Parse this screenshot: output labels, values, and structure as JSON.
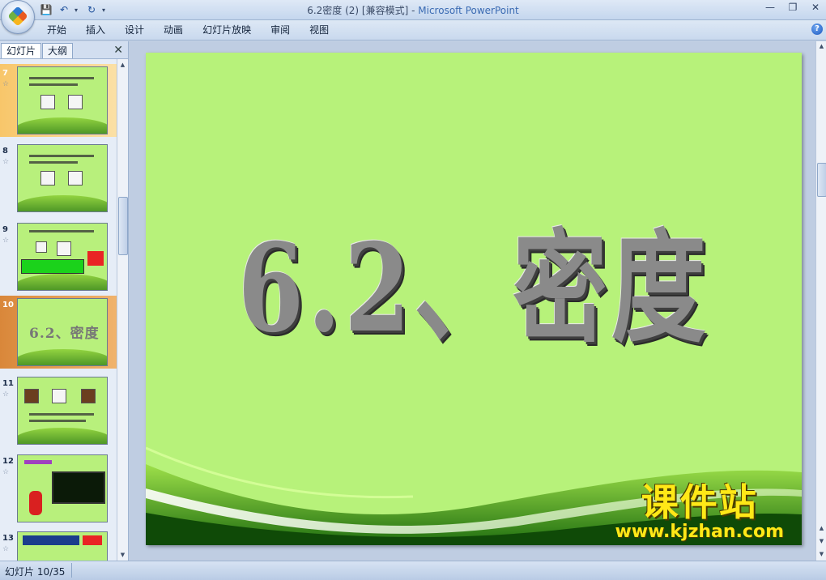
{
  "window": {
    "doc_title": "6.2密度 (2) [兼容模式]",
    "separator": " - ",
    "app_name": "Microsoft PowerPoint",
    "controls": [
      "—",
      "❐",
      "✕"
    ]
  },
  "quick_access": [
    {
      "icon": "save-icon",
      "glyph": "💾"
    },
    {
      "icon": "undo-icon",
      "glyph": "↶"
    },
    {
      "icon": "redo-icon",
      "glyph": "↻"
    }
  ],
  "ribbon": {
    "tabs": [
      "开始",
      "插入",
      "设计",
      "动画",
      "幻灯片放映",
      "审阅",
      "视图"
    ],
    "help": "?"
  },
  "left_pane": {
    "tab_slides": "幻灯片",
    "tab_outline": "大纲",
    "close": "✕",
    "thumbnails": [
      {
        "number": "7",
        "star": "☆"
      },
      {
        "number": "8",
        "star": "☆"
      },
      {
        "number": "9",
        "star": "☆"
      },
      {
        "number": "10",
        "star": "",
        "text": "6.2、密度"
      },
      {
        "number": "11",
        "star": "☆"
      },
      {
        "number": "12",
        "star": "☆"
      },
      {
        "number": "13",
        "star": "☆"
      }
    ]
  },
  "slide": {
    "title": "6.2、密度",
    "background": "#b7f27a"
  },
  "watermark": {
    "title": "课件站",
    "url": "www.kjzhan.com"
  },
  "status": {
    "slide_position": "幻灯片 10/35"
  }
}
